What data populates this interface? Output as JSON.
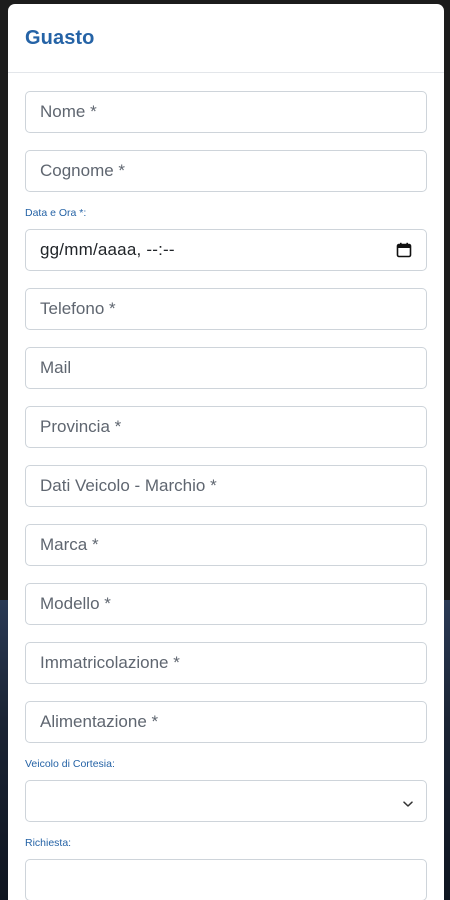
{
  "modal": {
    "title": "Guasto"
  },
  "form": {
    "nome_placeholder": "Nome *",
    "cognome_placeholder": "Cognome *",
    "data_label": "Data e Ora *:",
    "data_value": "gg/mm/aaaa, --:--",
    "telefono_placeholder": "Telefono *",
    "mail_placeholder": "Mail",
    "provincia_placeholder": "Provincia *",
    "dati_veicolo_placeholder": "Dati Veicolo - Marchio *",
    "marca_placeholder": "Marca *",
    "modello_placeholder": "Modello *",
    "immatricolazione_placeholder": "Immatricolazione *",
    "alimentazione_placeholder": "Alimentazione *",
    "cortesia_label": "Veicolo di Cortesia:",
    "cortesia_value": "",
    "richiesta_label": "Richiesta:"
  },
  "icons": {
    "calendar": "calendar-icon",
    "select_chevron": "chevron-down-icon"
  },
  "colors": {
    "accent": "#2563a6",
    "border": "#ced4da",
    "placeholder": "#5f6670"
  }
}
